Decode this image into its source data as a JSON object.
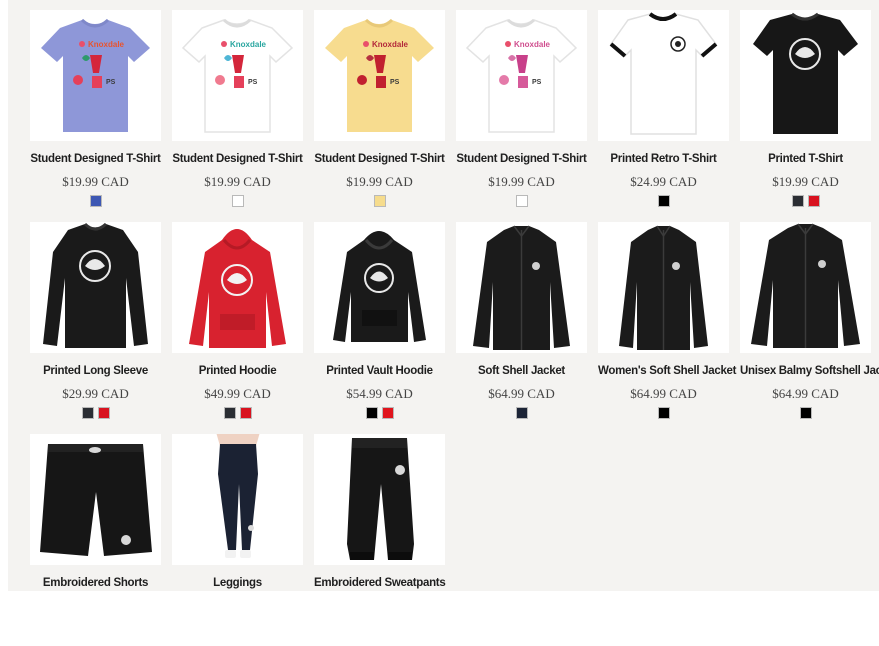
{
  "colors": {
    "periwinkle": "#8e97d8",
    "white": "#ffffff",
    "butter": "#f7dc8f",
    "black": "#1c1c1c",
    "red": "#d8222f",
    "navy_swatch": "#1c2436",
    "blue_swatch": "#3a56b0",
    "charcoal_swatch": "#2a2d33"
  },
  "products": [
    {
      "name": "Student Designed T-Shirt",
      "price": "$19.99 CAD",
      "icon": "tshirt-knoxdale-icon",
      "swatches": [
        "#3d57b3"
      ]
    },
    {
      "name": "Student Designed T-Shirt",
      "price": "$19.99 CAD",
      "icon": "tshirt-knoxdale-icon",
      "swatches": [
        "#ffffff"
      ]
    },
    {
      "name": "Student Designed T-Shirt",
      "price": "$19.99 CAD",
      "icon": "tshirt-knoxdale-icon",
      "swatches": [
        "#f6dc8d"
      ]
    },
    {
      "name": "Student Designed T-Shirt",
      "price": "$19.99 CAD",
      "icon": "tshirt-knoxdale-icon",
      "swatches": [
        "#ffffff"
      ]
    },
    {
      "name": "Printed Retro T-Shirt",
      "price": "$24.99 CAD",
      "icon": "ringer-tshirt-icon",
      "swatches": [
        "#000000"
      ]
    },
    {
      "name": "Printed T-Shirt",
      "price": "$19.99 CAD",
      "icon": "black-tshirt-icon",
      "swatches": [
        "#2a2d33",
        "#d8121f"
      ]
    },
    {
      "name": "Printed Long Sleeve",
      "price": "$29.99 CAD",
      "icon": "long-sleeve-icon",
      "swatches": [
        "#2a2d33",
        "#d8121f"
      ]
    },
    {
      "name": "Printed Hoodie",
      "price": "$49.99 CAD",
      "icon": "red-hoodie-icon",
      "swatches": [
        "#2a2d33",
        "#d8121f"
      ]
    },
    {
      "name": "Printed Vault Hoodie",
      "price": "$54.99 CAD",
      "icon": "black-hoodie-icon",
      "swatches": [
        "#000000",
        "#e0141d"
      ]
    },
    {
      "name": "Soft Shell Jacket",
      "price": "$64.99 CAD",
      "icon": "jacket-icon",
      "swatches": [
        "#1c2436"
      ]
    },
    {
      "name": "Women's Soft Shell Jacket",
      "price": "$64.99 CAD",
      "icon": "jacket-icon",
      "swatches": [
        "#000000"
      ]
    },
    {
      "name": "Unisex Balmy Softshell Jacket",
      "price": "$64.99 CAD",
      "icon": "jacket-icon",
      "swatches": [
        "#000000"
      ]
    },
    {
      "name": "Embroidered Shorts",
      "price": "",
      "icon": "shorts-icon",
      "swatches": []
    },
    {
      "name": "Leggings",
      "price": "",
      "icon": "leggings-icon",
      "swatches": []
    },
    {
      "name": "Embroidered Sweatpants",
      "price": "",
      "icon": "sweatpants-icon",
      "swatches": []
    }
  ],
  "print_text": {
    "knoxdale": "Knoxdale",
    "ps": "PS"
  }
}
